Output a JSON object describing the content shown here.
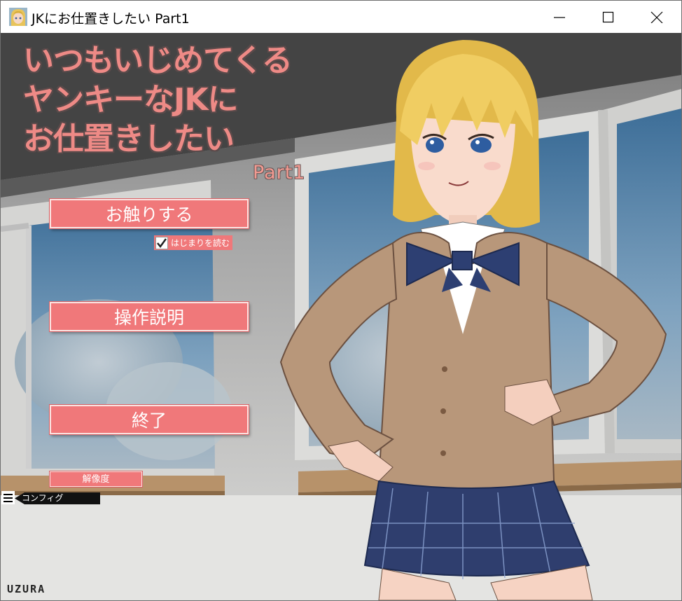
{
  "window": {
    "title": "JKにお仕置きしたい Part1",
    "icon": "character-portrait-icon",
    "controls": [
      "minimize-icon",
      "maximize-icon",
      "close-icon"
    ]
  },
  "game_title": {
    "line1": "いつもいじめてくる",
    "line2": "ヤンキーなJKに",
    "line3": "お仕置きしたい",
    "part": "Part1"
  },
  "menu": {
    "touch": "お触りする",
    "intro_checkbox": "はじまりを読む",
    "intro_checked": true,
    "help": "操作説明",
    "quit": "終了",
    "resolution": "解像度"
  },
  "config": {
    "label": "コンフィグ",
    "menu_icon": "hamburger-menu-icon"
  },
  "credit": "UZURA",
  "colors": {
    "button": "#f0787a",
    "title_fill": "#ee8a86",
    "title_outline": "#5a4a4a"
  }
}
